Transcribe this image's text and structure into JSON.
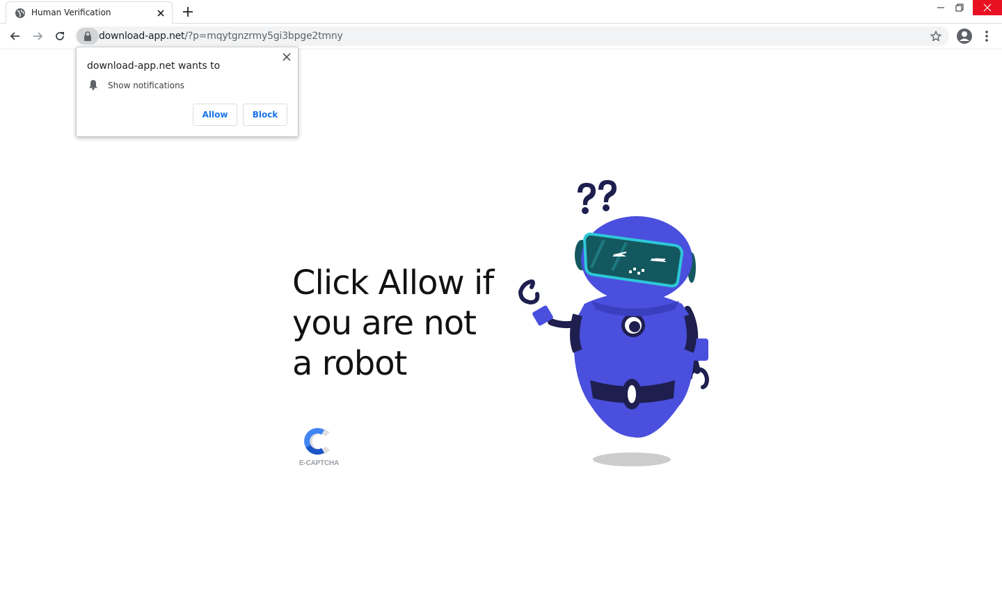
{
  "browser": {
    "tab": {
      "title": "Human Verification"
    },
    "address": {
      "host": "download-app.net",
      "path": "/?p=mqytgnzrmy5gi3bpge2tmny"
    }
  },
  "permission_prompt": {
    "title": "download-app.net wants to",
    "permission": "Show notifications",
    "allow_label": "Allow",
    "block_label": "Block"
  },
  "page": {
    "headline": "Click Allow if you are not a robot",
    "captcha_label": "E-CAPTCHA"
  },
  "colors": {
    "robot_body": "#4a4fdd",
    "robot_dark": "#1e1f4f",
    "visor": "#14585f",
    "visor_rim": "#2ec7d8",
    "link_blue": "#1a73e8",
    "close_red": "#e81123"
  }
}
